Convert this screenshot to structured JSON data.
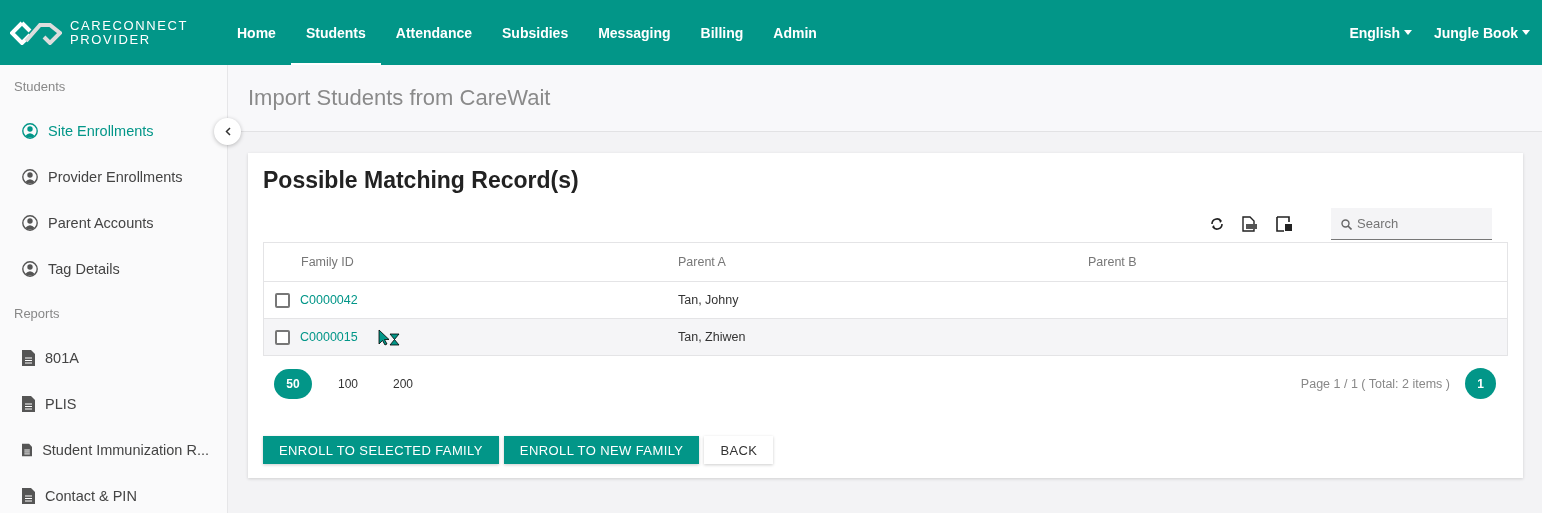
{
  "brand": {
    "line1": "CARECONNECT",
    "line2": "PROVIDER"
  },
  "nav": [
    {
      "label": "Home",
      "selected": false
    },
    {
      "label": "Students",
      "selected": true
    },
    {
      "label": "Attendance",
      "selected": false
    },
    {
      "label": "Subsidies",
      "selected": false
    },
    {
      "label": "Messaging",
      "selected": false
    },
    {
      "label": "Billing",
      "selected": false
    },
    {
      "label": "Admin",
      "selected": false
    }
  ],
  "nav_right": [
    "English",
    "Jungle Book"
  ],
  "sidebar": [
    {
      "heading": "Students",
      "items": [
        {
          "label": "Site Enrollments",
          "kind": "person",
          "selected": true
        },
        {
          "label": "Provider Enrollments",
          "kind": "person",
          "selected": false
        },
        {
          "label": "Parent Accounts",
          "kind": "person",
          "selected": false
        },
        {
          "label": "Tag Details",
          "kind": "person",
          "selected": false
        }
      ]
    },
    {
      "heading": "Reports",
      "items": [
        {
          "label": "801A",
          "kind": "document",
          "selected": false
        },
        {
          "label": "PLIS",
          "kind": "document",
          "selected": false
        },
        {
          "label": "Student Immunization R...",
          "kind": "document",
          "selected": false
        },
        {
          "label": "Contact & PIN",
          "kind": "document",
          "selected": false
        }
      ]
    }
  ],
  "page_title": "Import Students from CareWait",
  "card_title": "Possible Matching Record(s)",
  "search": {
    "placeholder": "Search"
  },
  "table": {
    "columns": [
      "Family ID",
      "Parent A",
      "Parent B"
    ],
    "rows": [
      {
        "family_id": "C0000042",
        "parent_a": "Tan, Johny",
        "checked": false,
        "highlighted": false
      },
      {
        "family_id": "C0000015",
        "parent_a": "Tan, Zhiwen",
        "checked": false,
        "highlighted": true
      }
    ]
  },
  "page_sizes": [
    {
      "label": "50",
      "selected": true
    },
    {
      "label": "100",
      "selected": false
    },
    {
      "label": "200",
      "selected": false
    }
  ],
  "page_info": "Page 1 / 1 ( Total: 2 items )",
  "pages": [
    {
      "label": "1",
      "selected": true
    }
  ],
  "buttons": [
    {
      "label": "ENROLL TO SELECTED FAMILY",
      "kind": "primary"
    },
    {
      "label": "ENROLL TO NEW FAMILY",
      "kind": "primary"
    },
    {
      "label": "BACK",
      "kind": "plain"
    }
  ]
}
